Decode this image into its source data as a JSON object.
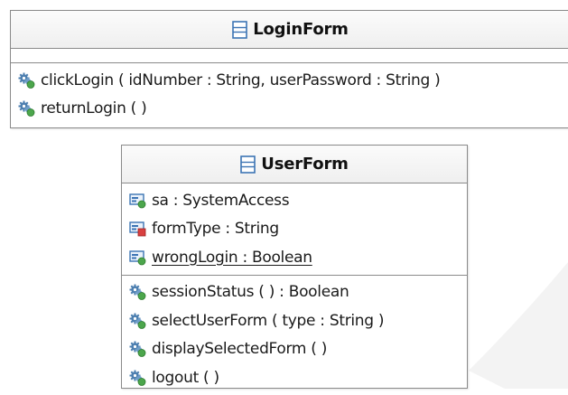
{
  "classes": [
    {
      "name": "LoginForm",
      "attributes": [],
      "operations": [
        "clickLogin ( idNumber : String, userPassword : String )",
        "returnLogin ( )"
      ]
    },
    {
      "name": "UserForm",
      "attributes": [
        {
          "text": "sa : SystemAccess",
          "visibility": "public",
          "static": false
        },
        {
          "text": "formType : String",
          "visibility": "private",
          "static": false
        },
        {
          "text": "wrongLogin : Boolean",
          "visibility": "public",
          "static": true
        }
      ],
      "operations": [
        "sessionStatus ( ) : Boolean",
        "selectUserForm ( type : String )",
        "displaySelectedForm ( )",
        "logout ( )"
      ]
    }
  ],
  "colors": {
    "border": "#8a8a8a",
    "class_icon": "#3c74b4",
    "public_marker": "#4ca64c",
    "private_marker": "#d94040",
    "gear": "#4d7fb0",
    "text": "#1a1a1a",
    "background_shape": "#f2f2f2"
  },
  "icons": {
    "class": "class-icon",
    "attribute": "field-icon",
    "operation": "gear-method-icon"
  }
}
